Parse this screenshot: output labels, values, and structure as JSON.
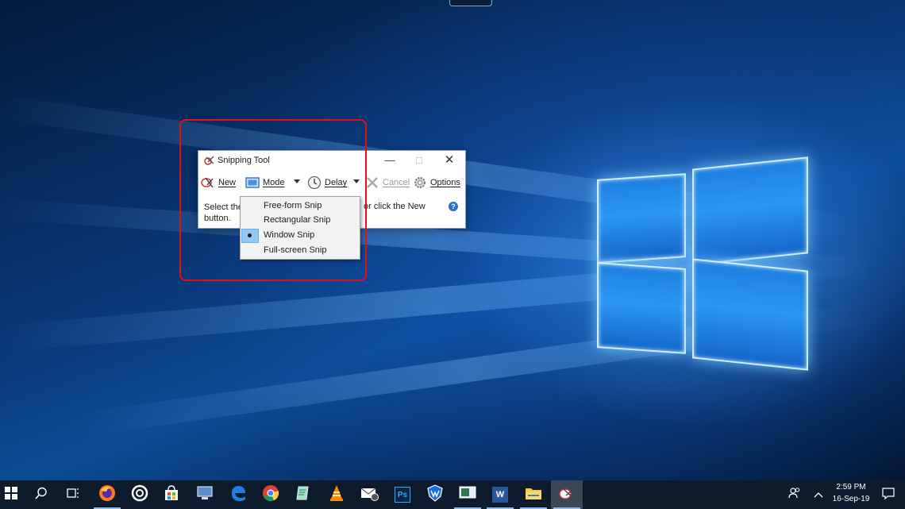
{
  "snipping_tool": {
    "title": "Snipping Tool",
    "toolbar": {
      "new_label": "New",
      "mode_label": "Mode",
      "delay_label": "Delay",
      "cancel_label": "Cancel",
      "options_label": "Options"
    },
    "hint_left_line1": "Select the",
    "hint_left_line2": "button.",
    "hint_right": "or click the New",
    "help_glyph": "?"
  },
  "mode_menu": {
    "items": [
      {
        "label": "Free-form Snip",
        "selected": false
      },
      {
        "label": "Rectangular Snip",
        "selected": false
      },
      {
        "label": "Window Snip",
        "selected": true
      },
      {
        "label": "Full-screen Snip",
        "selected": false
      }
    ]
  },
  "taskbar": {
    "apps": [
      "start-icon",
      "search-icon",
      "task-view-icon",
      "firefox-icon",
      "cortana-ring-icon",
      "store-icon",
      "network-app-icon",
      "edge-icon",
      "chrome-icon",
      "notepad-icon",
      "vlc-icon",
      "mail-icon",
      "photoshop-icon",
      "shield-app-icon",
      "monitor-app-icon",
      "word-icon",
      "file-explorer-icon",
      "snipping-tool-icon"
    ],
    "photoshop_label": "Ps",
    "word_label": "W",
    "time": "2:59 PM",
    "date": "16-Sep-19"
  },
  "colors": {
    "highlight": "#e0101e",
    "taskbar": "#0d1b2c",
    "selected_bg": "#90c8f6"
  }
}
